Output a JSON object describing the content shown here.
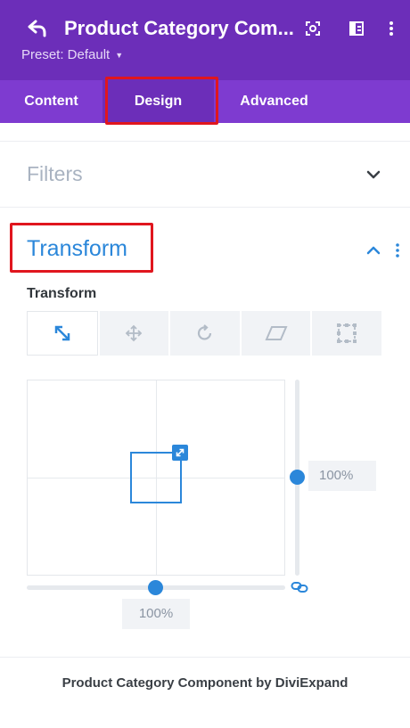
{
  "header": {
    "title": "Product Category Com...",
    "preset_label": "Preset: Default",
    "icons": [
      "back-arrow-icon",
      "focus-icon",
      "split-view-icon",
      "more-vertical-icon"
    ]
  },
  "tabs": [
    {
      "label": "Content",
      "active": false
    },
    {
      "label": "Design",
      "active": true
    },
    {
      "label": "Advanced",
      "active": false
    }
  ],
  "sections": {
    "filters": {
      "label": "Filters",
      "expanded": false
    },
    "transform": {
      "label": "Transform",
      "expanded": true,
      "field_label": "Transform",
      "tools": [
        {
          "icon": "scale-icon",
          "active": true
        },
        {
          "icon": "translate-move-icon",
          "active": false
        },
        {
          "icon": "rotate-icon",
          "active": false
        },
        {
          "icon": "skew-icon",
          "active": false
        },
        {
          "icon": "origin-icon",
          "active": false
        }
      ],
      "scale_y": "100%",
      "scale_x": "100%"
    }
  },
  "footer": {
    "text": "Product Category Component by DiviExpand"
  },
  "colors": {
    "header_purple": "#6c2eb9",
    "tabs_purple": "#7e3bd0",
    "accent_blue": "#2b87da",
    "highlight_red": "#e0161e"
  }
}
